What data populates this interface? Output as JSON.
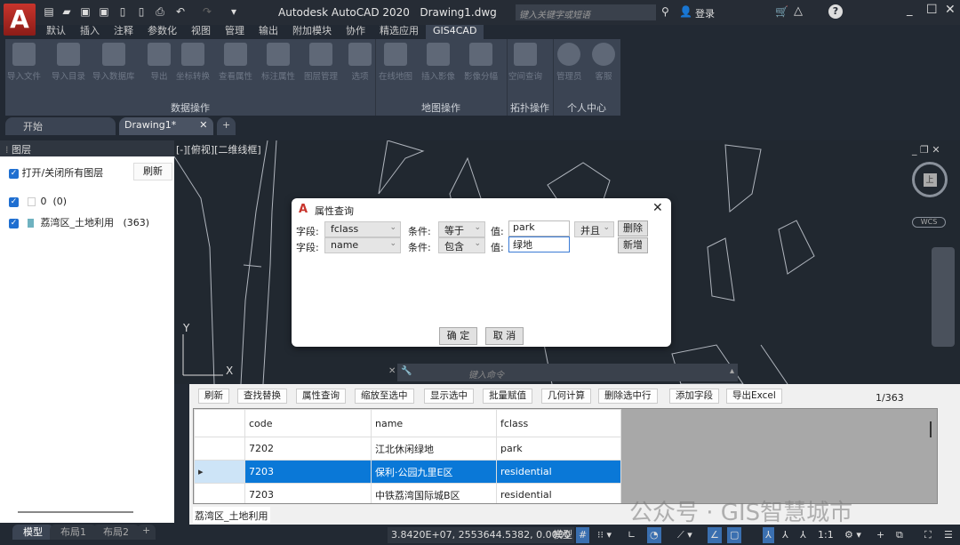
{
  "app": {
    "logo": "A",
    "title": "Autodesk AutoCAD 2020",
    "filename": "Drawing1.dwg",
    "search_placeholder": "键入关键字或短语",
    "login": "登录"
  },
  "ribbon_tabs": [
    "默认",
    "插入",
    "注释",
    "参数化",
    "视图",
    "管理",
    "输出",
    "附加模块",
    "协作",
    "精选应用",
    "GIS4CAD"
  ],
  "ribbon_buttons": [
    "导入文件",
    "导入目录",
    "导入数据库",
    "导出",
    "坐标转换",
    "查看属性",
    "标注属性",
    "图层管理",
    "选项",
    "在线地图",
    "插入影像",
    "影像分幅",
    "空间查询",
    "管理员",
    "客服"
  ],
  "ribbon_groups": [
    "数据操作",
    "地图操作",
    "拓扑操作",
    "个人中心"
  ],
  "doc_tabs": [
    "开始",
    "Drawing1*"
  ],
  "layers": {
    "title": "图层",
    "toggle_all": "打开/关闭所有图层",
    "refresh": "刷新",
    "items": [
      {
        "name": "0",
        "count": "(0)",
        "color": "#ffffff"
      },
      {
        "name": "荔湾区_土地利用",
        "count": "(363)",
        "color": "#6fb2c0"
      }
    ]
  },
  "viewport_label": "[-][俯视][二维线框]",
  "viewcube": {
    "top": "上",
    "wcs": "WCS"
  },
  "dialog": {
    "title": "属性查询",
    "field_label": "字段:",
    "cond_label": "条件:",
    "value_label": "值:",
    "rows": [
      {
        "field": "fclass",
        "cond": "等于",
        "value": "park",
        "logic": "并且",
        "btn": "删除"
      },
      {
        "field": "name",
        "cond": "包含",
        "value": "绿地",
        "btn": "新增"
      }
    ],
    "ok": "确 定",
    "cancel": "取 消"
  },
  "command_placeholder": "键入命令",
  "attr": {
    "toolbar": [
      "刷新",
      "查找替换",
      "属性查询",
      "缩放至选中",
      "显示选中",
      "批量赋值",
      "几何计算",
      "删除选中行",
      "添加字段",
      "导出Excel"
    ],
    "count": "1/363",
    "columns": [
      "code",
      "name",
      "fclass"
    ],
    "rows": [
      [
        "7202",
        "江北休闲绿地",
        "park"
      ],
      [
        "7203",
        "保利·公园九里E区",
        "residential"
      ],
      [
        "7203",
        "中铁荔湾国际城B区",
        "residential"
      ]
    ],
    "layer_tab": "荔湾区_土地利用"
  },
  "layout_tabs": [
    "模型",
    "布局1",
    "布局2"
  ],
  "status": {
    "coords": "3.8420E+07, 2553644.5382, 0.0000",
    "model": "模型",
    "scale": "1:1"
  },
  "watermark": "公众号 · GIS智慧城市"
}
